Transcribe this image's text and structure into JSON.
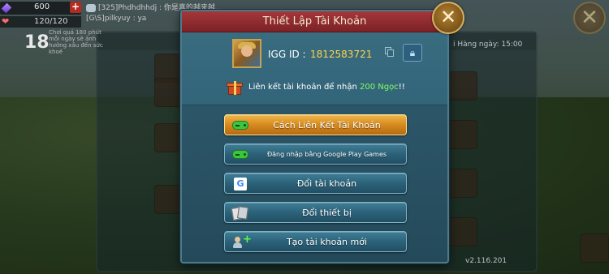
{
  "hud": {
    "gems": "600",
    "stamina": "120/120",
    "level": "18",
    "note": "Chơi quá 180 phút mỗi ngày sẽ ảnh hưởng xấu đến sức khoẻ",
    "chat_line_1": "[325]Phdhdhhdj : 你是真的越来越…",
    "chat_line_2": "[G\\S]pilkyuy : ya"
  },
  "background": {
    "right_text": "i Hàng ngày: 15:00",
    "version": "v2.116.201"
  },
  "dialog": {
    "title": "Thiết Lập Tài Khoản",
    "close_label": "✕",
    "igg_label": "IGG ID :",
    "igg_id": "1812583721",
    "promo_prefix": "Liên kết tài khoản để nhận ",
    "promo_highlight": "200 Ngọc",
    "promo_suffix": "!!",
    "buttons": [
      {
        "label": "Cách Liên Kết Tài Khoản",
        "icon": "gamepad-icon",
        "style": "orange"
      },
      {
        "label": "Đăng nhập bằng Google Play Games",
        "icon": "google-play-games-icon",
        "style": "blue"
      },
      {
        "label": "Đổi tài khoản",
        "icon": "google-icon",
        "style": "blue"
      },
      {
        "label": "Đổi thiết bị",
        "icon": "devices-icon",
        "style": "blue"
      },
      {
        "label": "Tạo tài khoản mới",
        "icon": "add-user-icon",
        "style": "blue"
      }
    ]
  },
  "colors": {
    "title_bar": "#8c2b2e",
    "panel": "#2f5a6c",
    "igg_id": "#ffd54a",
    "promo_highlight": "#7dff5f",
    "primary_button": "#e2a033"
  }
}
